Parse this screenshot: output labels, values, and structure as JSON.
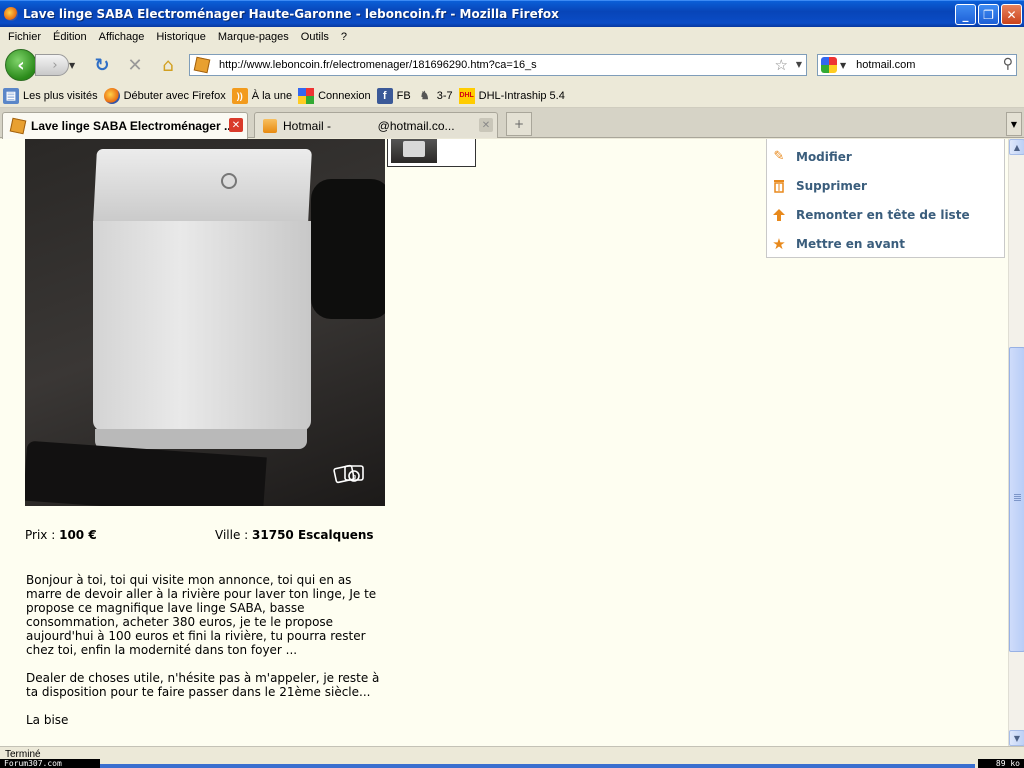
{
  "window": {
    "title": "Lave linge SABA Electroménager Haute-Garonne - leboncoin.fr - Mozilla Firefox",
    "buttons": {
      "minimize": "_",
      "maximize": "❐",
      "close": "✕"
    }
  },
  "menubar": [
    "Fichier",
    "Édition",
    "Affichage",
    "Historique",
    "Marque-pages",
    "Outils",
    "?"
  ],
  "navbar": {
    "url": "http://www.leboncoin.fr/electromenager/181696290.htm?ca=16_s",
    "search_value": "hotmail.com",
    "icons": [
      "back-icon",
      "forward-icon",
      "reload-icon",
      "stop-icon",
      "home-icon",
      "bookmark-star-icon",
      "search-icon"
    ]
  },
  "bookmarks": [
    {
      "label": "Les plus visités",
      "icon": "bookmarks-folder-icon"
    },
    {
      "label": "Débuter avec Firefox",
      "icon": "firefox-icon"
    },
    {
      "label": "À la une",
      "icon": "rss-icon"
    },
    {
      "label": "Connexion",
      "icon": "windows-live-icon"
    },
    {
      "label": "FB",
      "icon": "facebook-icon"
    },
    {
      "label": "3-7",
      "icon": "jester-icon"
    },
    {
      "label": "DHL-Intraship 5.4",
      "icon": "dhl-icon"
    }
  ],
  "tabs": [
    {
      "label": "Lave linge SABA Electroménager ...",
      "active": true
    },
    {
      "label": "Hotmail -              @hotmail.co...",
      "active": false
    }
  ],
  "listing": {
    "price_label": "Prix :",
    "price_value": "100 €",
    "city_label": "Ville :",
    "city_value": "31750 Escalquens",
    "description": [
      "Bonjour à toi, toi qui visite mon annonce, toi qui en as marre de devoir aller à la rivière pour laver ton linge, Je te propose ce magnifique lave linge SABA, basse consommation, acheter 380 euros, je te le propose aujourd'hui à 100 euros et fini la rivière, tu pourra rester chez toi, enfin la modernité dans ton foyer ...",
      "Dealer de choses utile, n'hésite pas à m'appeler, je reste à ta disposition pour te faire passer dans le 21ème siècle...",
      "La bise"
    ]
  },
  "actions": [
    {
      "label": "Modifier",
      "icon": "pencil-icon"
    },
    {
      "label": "Supprimer",
      "icon": "trash-icon"
    },
    {
      "label": "Remonter en tête de liste",
      "icon": "arrow-up-icon"
    },
    {
      "label": "Mettre en avant",
      "icon": "star-icon"
    }
  ],
  "status": {
    "text": "Terminé",
    "watermark": "Forum307.com",
    "size": "89 ko"
  },
  "colors": {
    "page_background": "#fefef1",
    "action_link": "#3a5d7c",
    "action_icon": "#e8891c"
  }
}
